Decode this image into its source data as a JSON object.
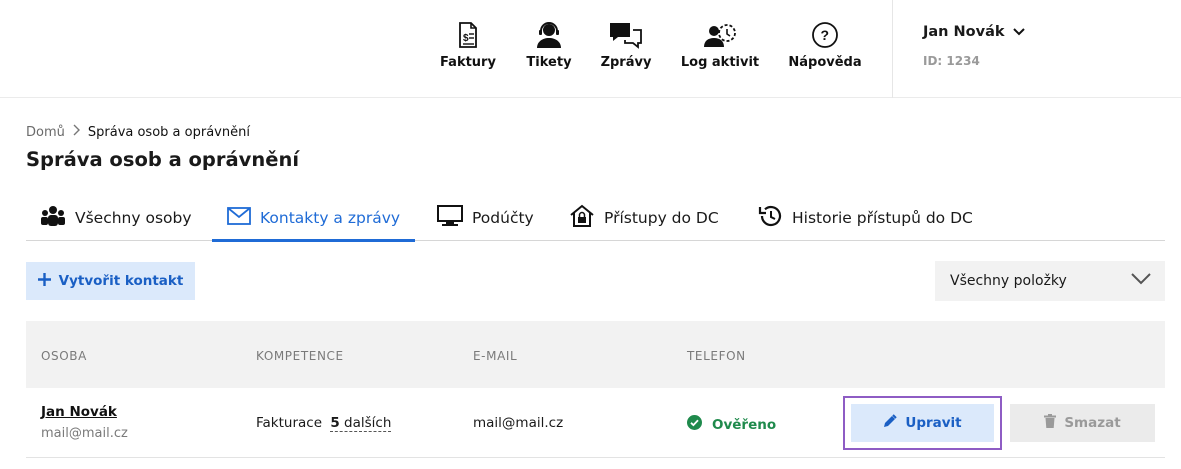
{
  "header": {
    "nav": [
      {
        "label": "Faktury",
        "icon": "invoice-icon"
      },
      {
        "label": "Tikety",
        "icon": "support-agent-icon"
      },
      {
        "label": "Zprávy",
        "icon": "chat-bubbles-icon"
      },
      {
        "label": "Log aktivit",
        "icon": "user-activity-icon"
      },
      {
        "label": "Nápověda",
        "icon": "help-icon"
      }
    ],
    "user": {
      "name": "Jan Novák",
      "id": "ID: 1234"
    }
  },
  "breadcrumb": {
    "home": "Domů",
    "current": "Správa osob a oprávnění"
  },
  "page_title": "Správa osob a oprávnění",
  "tabs": [
    {
      "label": "Všechny osoby",
      "icon": "people-icon",
      "active": false
    },
    {
      "label": "Kontakty a zprávy",
      "icon": "envelope-icon",
      "active": true
    },
    {
      "label": "Podúčty",
      "icon": "monitor-icon",
      "active": false
    },
    {
      "label": "Přístupy do DC",
      "icon": "house-lock-icon",
      "active": false
    },
    {
      "label": "Historie přístupů do DC",
      "icon": "history-icon",
      "active": false
    }
  ],
  "toolbar": {
    "create_label": "Vytvořit kontakt",
    "filter_value": "Všechny položky"
  },
  "table": {
    "columns": [
      "OSOBA",
      "KOMPETENCE",
      "E-MAIL",
      "TELEFON"
    ],
    "rows": [
      {
        "name": "Jan Novák",
        "name_email": "mail@mail.cz",
        "competence": "Fakturace",
        "more_count": "5",
        "more_label": "dalších",
        "email": "mail@mail.cz",
        "phone_status": "Ověřeno",
        "edit_label": "Upravit",
        "delete_label": "Smazat"
      }
    ]
  },
  "colors": {
    "accent": "#1f6bd6",
    "accent_bg": "#dbe9fb",
    "success": "#1f8a4c",
    "highlight": "#8e5cc4"
  }
}
